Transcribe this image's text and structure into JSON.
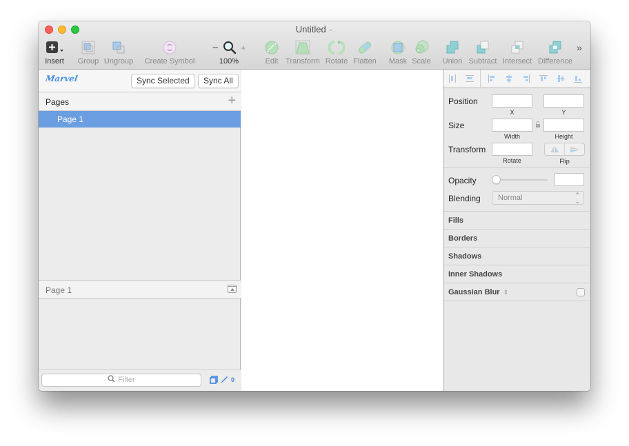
{
  "window": {
    "title": "Untitled",
    "title_chevron": "⌄"
  },
  "toolbar": {
    "insert": "Insert",
    "group": "Group",
    "ungroup": "Ungroup",
    "create_symbol": "Create Symbol",
    "zoom_minus": "−",
    "zoom_plus": "+",
    "zoom_level": "100%",
    "edit": "Edit",
    "transform": "Transform",
    "rotate": "Rotate",
    "flatten": "Flatten",
    "mask": "Mask",
    "scale": "Scale",
    "union": "Union",
    "subtract": "Subtract",
    "intersect": "Intersect",
    "difference": "Difference",
    "overflow": "»"
  },
  "left_panel": {
    "plugin_logo": "Marvel",
    "sync_selected": "Sync Selected",
    "sync_all": "Sync All",
    "pages_label": "Pages",
    "add_page": "+",
    "pages": [
      {
        "name": "Page 1",
        "selected": true
      }
    ],
    "layers_header": "Page 1",
    "filter_placeholder": "Filter",
    "filter_icon": "⌕",
    "slice_count": "0"
  },
  "inspector": {
    "position_label": "Position",
    "x_label": "X",
    "y_label": "Y",
    "x_value": "",
    "y_value": "",
    "size_label": "Size",
    "width_label": "Width",
    "height_label": "Height",
    "width_value": "",
    "height_value": "",
    "transform_label": "Transform",
    "rotate_label": "Rotate",
    "rotate_value": "",
    "flip_label": "Flip",
    "opacity_label": "Opacity",
    "opacity_value": "",
    "opacity_fraction": 0,
    "blending_label": "Blending",
    "blending_value": "Normal",
    "sections": [
      "Fills",
      "Borders",
      "Shadows",
      "Inner Shadows",
      "Gaussian Blur"
    ],
    "gaussian_updown": "⇕",
    "gaussian_enabled": false
  },
  "colors": {
    "selection": "#6b9ee0",
    "accent": "#3b82e0"
  }
}
